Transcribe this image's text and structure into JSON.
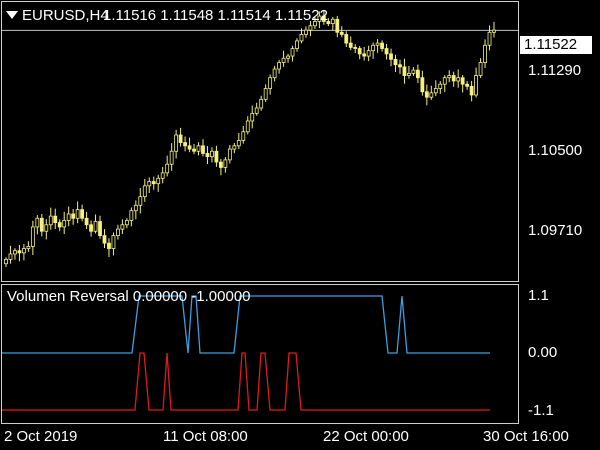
{
  "header": {
    "menu_icon": "triangle-down-icon",
    "symbol": "EURUSD,H4",
    "ohlc": "1.11516 1.11548 1.11514 1.11522"
  },
  "price_axis": {
    "current_price": "1.11522",
    "ticks": [
      "1.11290",
      "1.10500",
      "1.09710"
    ]
  },
  "indicator": {
    "label": "Volumen Reversal 0.00000 -1.00000",
    "ticks": [
      "1.1",
      "0.00",
      "-1.1"
    ],
    "colors": {
      "blue": "#3c9fe0",
      "red": "#e01a1a"
    }
  },
  "time_axis": {
    "ticks": [
      "2 Oct 2019",
      "11 Oct 08:00",
      "22 Oct 00:00",
      "30 Oct 16:00"
    ]
  },
  "colors": {
    "candle": "#f4f080",
    "background": "#000000",
    "frame": "#cfcfcf"
  },
  "chart_data": {
    "type": "line",
    "title": "EURUSD,H4",
    "ylim": [
      1.092,
      1.1178
    ],
    "close_series": [
      1.094,
      1.0945,
      1.0948,
      1.0946,
      1.095,
      1.0952,
      1.097,
      1.0978,
      1.0966,
      1.0972,
      1.098,
      1.0974,
      1.097,
      1.0976,
      1.0982,
      1.0978,
      1.0986,
      1.0978,
      1.0972,
      1.0966,
      1.0975,
      1.0962,
      1.0955,
      1.095,
      1.0962,
      1.0968,
      1.0972,
      1.0976,
      1.0985,
      1.099,
      1.0998,
      1.1008,
      1.1012,
      1.101,
      1.1015,
      1.102,
      1.1028,
      1.104,
      1.1055,
      1.1048,
      1.1045,
      1.1042,
      1.104,
      1.1045,
      1.1038,
      1.1035,
      1.104,
      1.103,
      1.1025,
      1.1032,
      1.1042,
      1.1045,
      1.105,
      1.1058,
      1.1068,
      1.1075,
      1.108,
      1.1088,
      1.1098,
      1.1108,
      1.1116,
      1.1122,
      1.1126,
      1.1128,
      1.1135,
      1.1142,
      1.1148,
      1.1152,
      1.1156,
      1.116,
      1.1165,
      1.116,
      1.1158,
      1.1162,
      1.115,
      1.1148,
      1.114,
      1.1136,
      1.1135,
      1.113,
      1.1128,
      1.1133,
      1.1138,
      1.114,
      1.1135,
      1.113,
      1.1125,
      1.112,
      1.1118,
      1.111,
      1.1112,
      1.1115,
      1.1108,
      1.1095,
      1.109,
      1.1094,
      1.1098,
      1.1102,
      1.1108,
      1.111,
      1.1105,
      1.1108,
      1.1102,
      1.11,
      1.1092,
      1.111,
      1.1122,
      1.1138,
      1.115,
      1.1152
    ],
    "indicator_blue": [
      [
        0,
        0
      ],
      [
        130,
        0
      ],
      [
        137,
        1.1
      ],
      [
        180,
        1.1
      ],
      [
        186,
        0
      ],
      [
        190,
        1.1
      ],
      [
        194,
        1.1
      ],
      [
        198,
        0
      ],
      [
        232,
        0
      ],
      [
        238,
        1.1
      ],
      [
        380,
        1.1
      ],
      [
        386,
        0
      ],
      [
        395,
        0
      ],
      [
        400,
        1.1
      ],
      [
        405,
        0
      ],
      [
        488,
        0
      ]
    ],
    "indicator_red": [
      [
        0,
        -1.1
      ],
      [
        133,
        -1.1
      ],
      [
        138,
        0
      ],
      [
        142,
        0
      ],
      [
        147,
        -1.1
      ],
      [
        161,
        -1.1
      ],
      [
        165,
        0
      ],
      [
        169,
        -1.1
      ],
      [
        236,
        -1.1
      ],
      [
        240,
        0
      ],
      [
        243,
        0
      ],
      [
        247,
        -1.1
      ],
      [
        255,
        -1.1
      ],
      [
        259,
        0
      ],
      [
        263,
        0
      ],
      [
        268,
        -1.1
      ],
      [
        283,
        -1.1
      ],
      [
        287,
        0
      ],
      [
        294,
        0
      ],
      [
        299,
        -1.1
      ],
      [
        488,
        -1.1
      ]
    ]
  }
}
